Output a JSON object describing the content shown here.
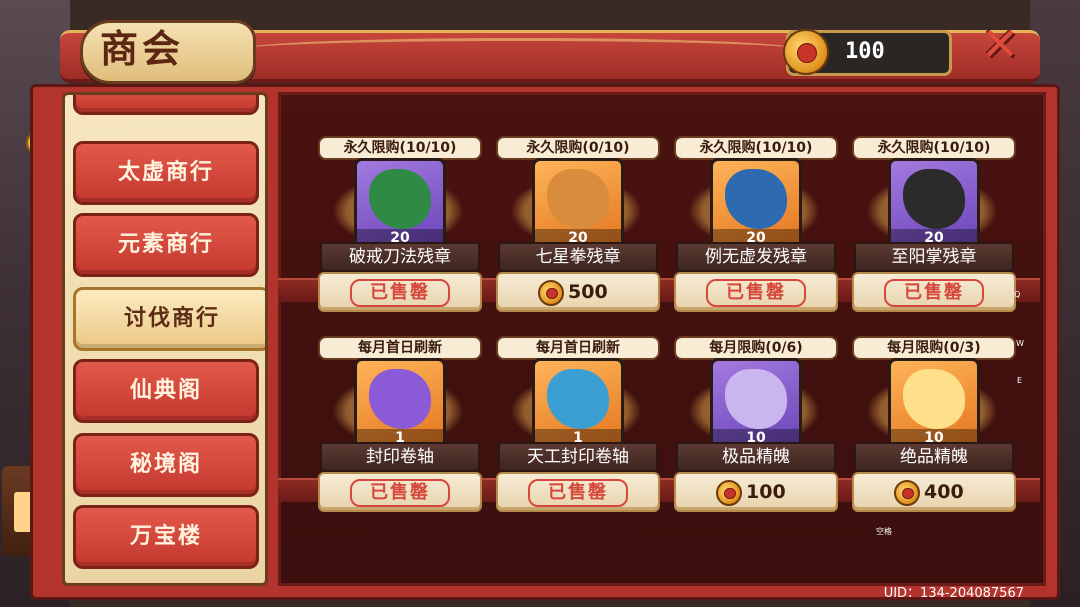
{
  "header": {
    "title": "商会",
    "currency_value": "100",
    "close_label": "✕"
  },
  "sidebar": {
    "items": [
      {
        "label": "",
        "stub": true
      },
      {
        "label": "太虚商行"
      },
      {
        "label": "元素商行"
      },
      {
        "label": "讨伐商行",
        "active": true
      },
      {
        "label": "仙典阁"
      },
      {
        "label": "秘境阁"
      },
      {
        "label": "万宝楼"
      }
    ]
  },
  "shop": {
    "items": [
      {
        "limit": "永久限购(10/10)",
        "name": "破戒刀法残章",
        "count": "20",
        "sold": "已售罄",
        "bg": "purple",
        "art": "#2e8a44"
      },
      {
        "limit": "永久限购(0/10)",
        "name": "七星拳残章",
        "count": "20",
        "price": "500",
        "bg": "orange",
        "art": "#d88c3c"
      },
      {
        "limit": "永久限购(10/10)",
        "name": "例无虚发残章",
        "count": "20",
        "sold": "已售罄",
        "bg": "orange",
        "art": "#2d6ab0"
      },
      {
        "limit": "永久限购(10/10)",
        "name": "至阳掌残章",
        "count": "20",
        "sold": "已售罄",
        "bg": "purple",
        "art": "#2b2b2b"
      },
      {
        "limit": "每月首日刷新",
        "name": "封印卷轴",
        "count": "1",
        "sold": "已售罄",
        "bg": "orange",
        "art": "#8b5ad6"
      },
      {
        "limit": "每月首日刷新",
        "name": "天工封印卷轴",
        "count": "1",
        "sold": "已售罄",
        "bg": "orange",
        "art": "#3b9fd4"
      },
      {
        "limit": "每月限购(0/6)",
        "name": "极品精魄",
        "count": "10",
        "price": "100",
        "bg": "purple",
        "art": "#c9b6ef"
      },
      {
        "limit": "每月限购(0/3)",
        "name": "绝品精魄",
        "count": "10",
        "price": "400",
        "bg": "orange",
        "art": "#ffe08a"
      }
    ]
  },
  "key_hints": [
    "Q",
    "W",
    "E",
    "空格"
  ],
  "footer": {
    "uid": "UID：134-204087567"
  }
}
